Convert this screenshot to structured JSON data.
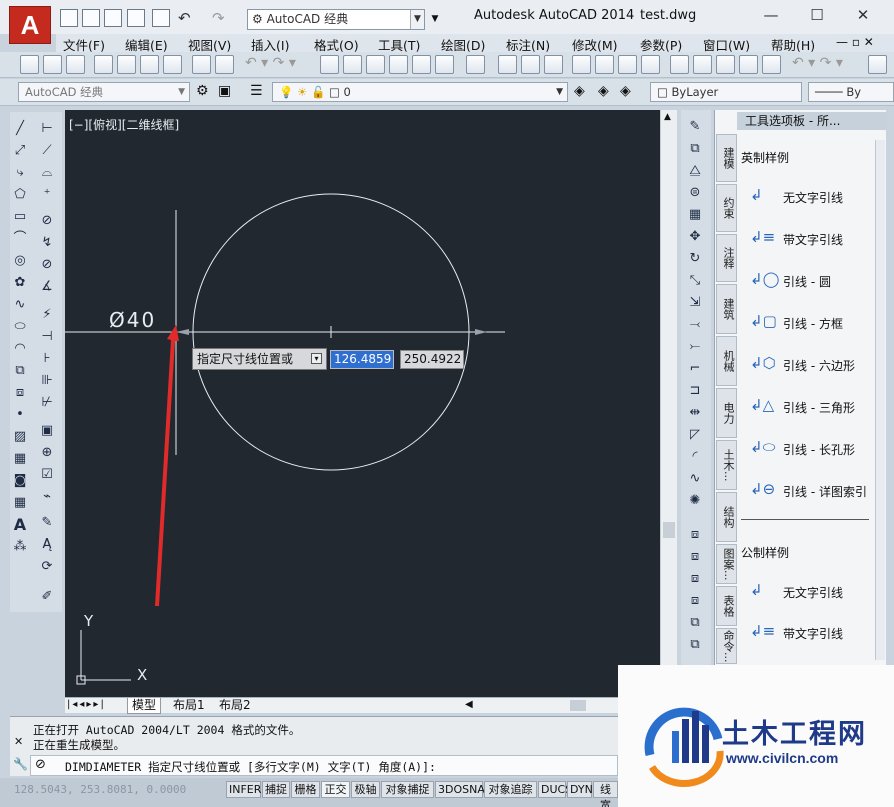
{
  "window": {
    "app_title": "Autodesk AutoCAD 2014",
    "file_name": "test.dwg"
  },
  "app_logo": {
    "glyph": "A"
  },
  "workspace_combo": {
    "value": "AutoCAD 经典"
  },
  "menu": {
    "items": [
      "文件(F)",
      "编辑(E)",
      "视图(V)",
      "插入(I)",
      "格式(O)",
      "工具(T)",
      "绘图(D)",
      "标注(N)",
      "修改(M)",
      "参数(P)",
      "窗口(W)",
      "帮助(H)"
    ]
  },
  "toolbar2": {
    "workspace": "AutoCAD 经典",
    "layer": "0",
    "linetype": "ByLayer",
    "right_label": "By"
  },
  "drawing": {
    "view_label": "[−][俯视][二维线框]",
    "dimension_text": "Ø40",
    "tooltip_prompt": "指定尺寸线位置或",
    "input_x": "126.4859",
    "input_y": "250.4922",
    "ucs_x": "X",
    "ucs_y": "Y"
  },
  "layout_tabs": [
    "模型",
    "布局1",
    "布局2"
  ],
  "palette": {
    "title": "工具选项板 - 所...",
    "tabs": [
      "建模",
      "约束",
      "注释",
      "建筑",
      "机械",
      "电力",
      "土木...",
      "结构",
      "图案...",
      "表格",
      "命令..."
    ],
    "section1": "英制样例",
    "items1": [
      "无文字引线",
      "带文字引线",
      "引线 - 圆",
      "引线 - 方框",
      "引线 - 六边形",
      "引线 - 三角形",
      "引线 - 长孔形",
      "引线 - 详图索引"
    ],
    "section2": "公制样例",
    "items2": [
      "无文字引线",
      "带文字引线"
    ]
  },
  "command": {
    "history1": "正在打开 AutoCAD 2004/LT 2004 格式的文件。",
    "history2": "正在重生成模型。",
    "prompt": "DIMDIAMETER 指定尺寸线位置或 [多行文字(M) 文字(T) 角度(A)]:"
  },
  "status": {
    "coords": "128.5043, 253.8081, 0.0000",
    "buttons": [
      "INFER",
      "捕捉",
      "栅格",
      "正交",
      "极轴",
      "对象捕捉",
      "3DOSNAP",
      "对象追踪",
      "DUCS",
      "DYN",
      "线宽"
    ]
  },
  "watermark": {
    "title": "土木工程网",
    "url": "www.civilcn.com"
  },
  "colors": {
    "canvas_bg": "#212830",
    "accent_red": "#e12a2a",
    "input_highlight": "#2f6fcf"
  }
}
